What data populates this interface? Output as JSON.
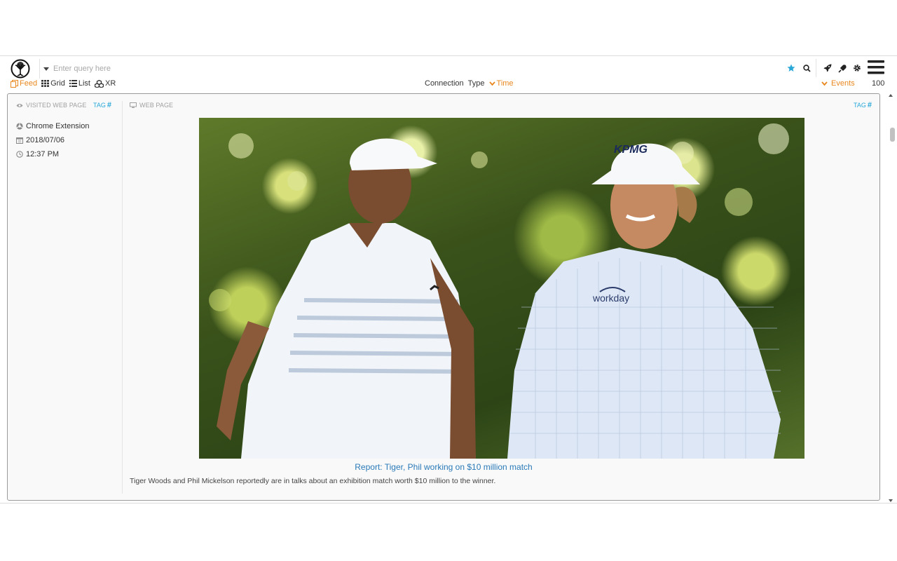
{
  "header": {
    "query_placeholder": "Enter query here",
    "logo_icon": "tree-of-life-icon",
    "tools": [
      "star-icon",
      "search-icon",
      "rocket-icon",
      "plug-icon",
      "gear-icon",
      "hamburger-menu-icon"
    ],
    "accent_color": "#29a8d8"
  },
  "views": {
    "items": [
      {
        "label": "Feed",
        "icon": "feed-icon",
        "active": true
      },
      {
        "label": "Grid",
        "icon": "grid-icon",
        "active": false
      },
      {
        "label": "List",
        "icon": "list-icon",
        "active": false
      },
      {
        "label": "XR",
        "icon": "cubes-icon",
        "active": false
      }
    ],
    "active_color": "#e8881e"
  },
  "sort": {
    "connection": "Connection",
    "type": "Type",
    "time": "Time",
    "events": "Events",
    "count": "100"
  },
  "card": {
    "left_header": "VISITED WEB PAGE",
    "right_header": "WEB PAGE",
    "tag_label": "TAG",
    "tag_symbol": "#",
    "source": "Chrome Extension",
    "date": "2018/07/06",
    "time": "12:37 PM",
    "title": "Report: Tiger, Phil working on $10 million match",
    "description": "Tiger Woods and Phil Mickelson reportedly are in talks about an exhibition match worth $10 million to the winner.",
    "image_logo_text": [
      "workday",
      "KPMG"
    ]
  }
}
